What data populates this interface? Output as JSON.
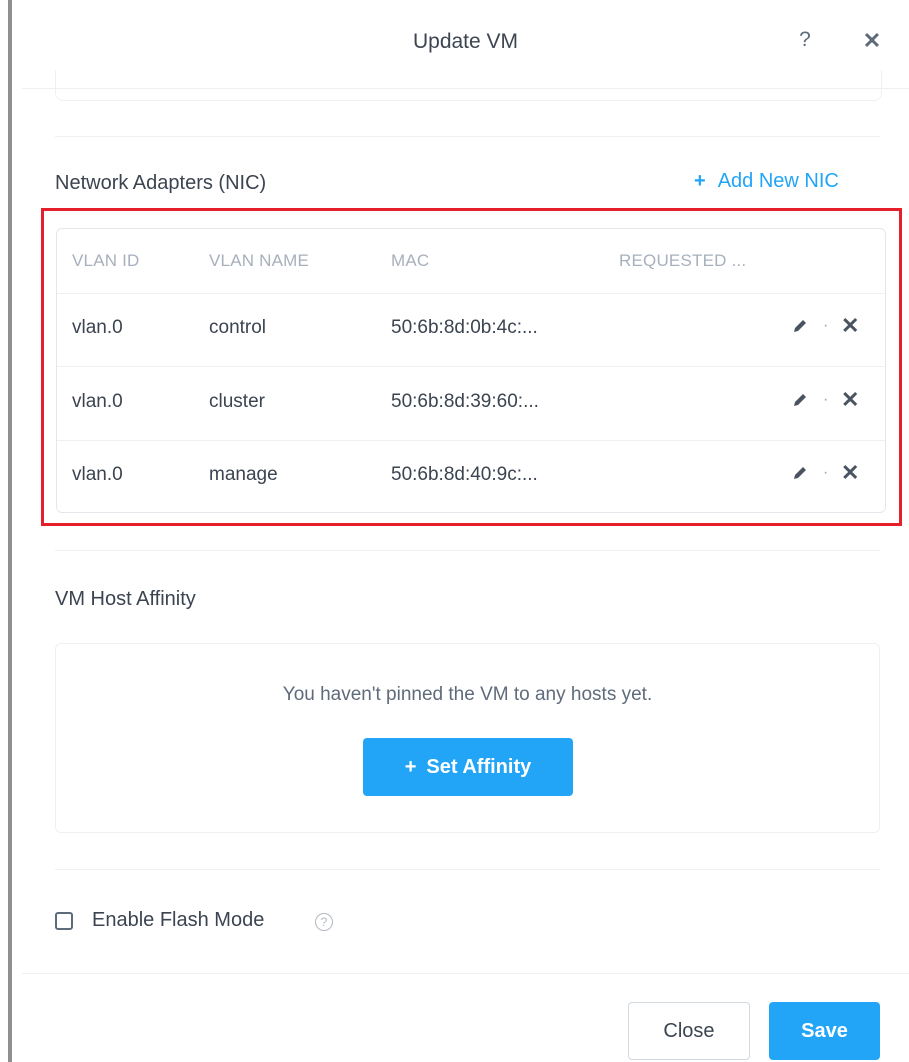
{
  "header": {
    "title": "Update VM",
    "help_label": "?",
    "close_label": "✕"
  },
  "nic_section": {
    "title": "Network Adapters (NIC)",
    "add_label": "Add New NIC",
    "add_prefix": "+",
    "columns": [
      "VLAN ID",
      "VLAN NAME",
      "MAC",
      "REQUESTED ..."
    ],
    "rows": [
      {
        "vlan_id": "vlan.0",
        "vlan_name": "control",
        "mac": "50:6b:8d:0b:4c:..."
      },
      {
        "vlan_id": "vlan.0",
        "vlan_name": "cluster",
        "mac": "50:6b:8d:39:60:..."
      },
      {
        "vlan_id": "vlan.0",
        "vlan_name": "manage",
        "mac": "50:6b:8d:40:9c:..."
      }
    ],
    "action_separator": "·",
    "delete_glyph": "✕"
  },
  "affinity_section": {
    "title": "VM Host Affinity",
    "message": "You haven't pinned the VM to any hosts yet.",
    "button_prefix": "+",
    "button_label": "Set Affinity"
  },
  "flash_mode": {
    "label": "Enable Flash Mode",
    "help_glyph": "?",
    "checked": false
  },
  "footer": {
    "close_label": "Close",
    "save_label": "Save"
  },
  "colors": {
    "accent": "#22a5f7",
    "highlight": "#e4202c"
  }
}
